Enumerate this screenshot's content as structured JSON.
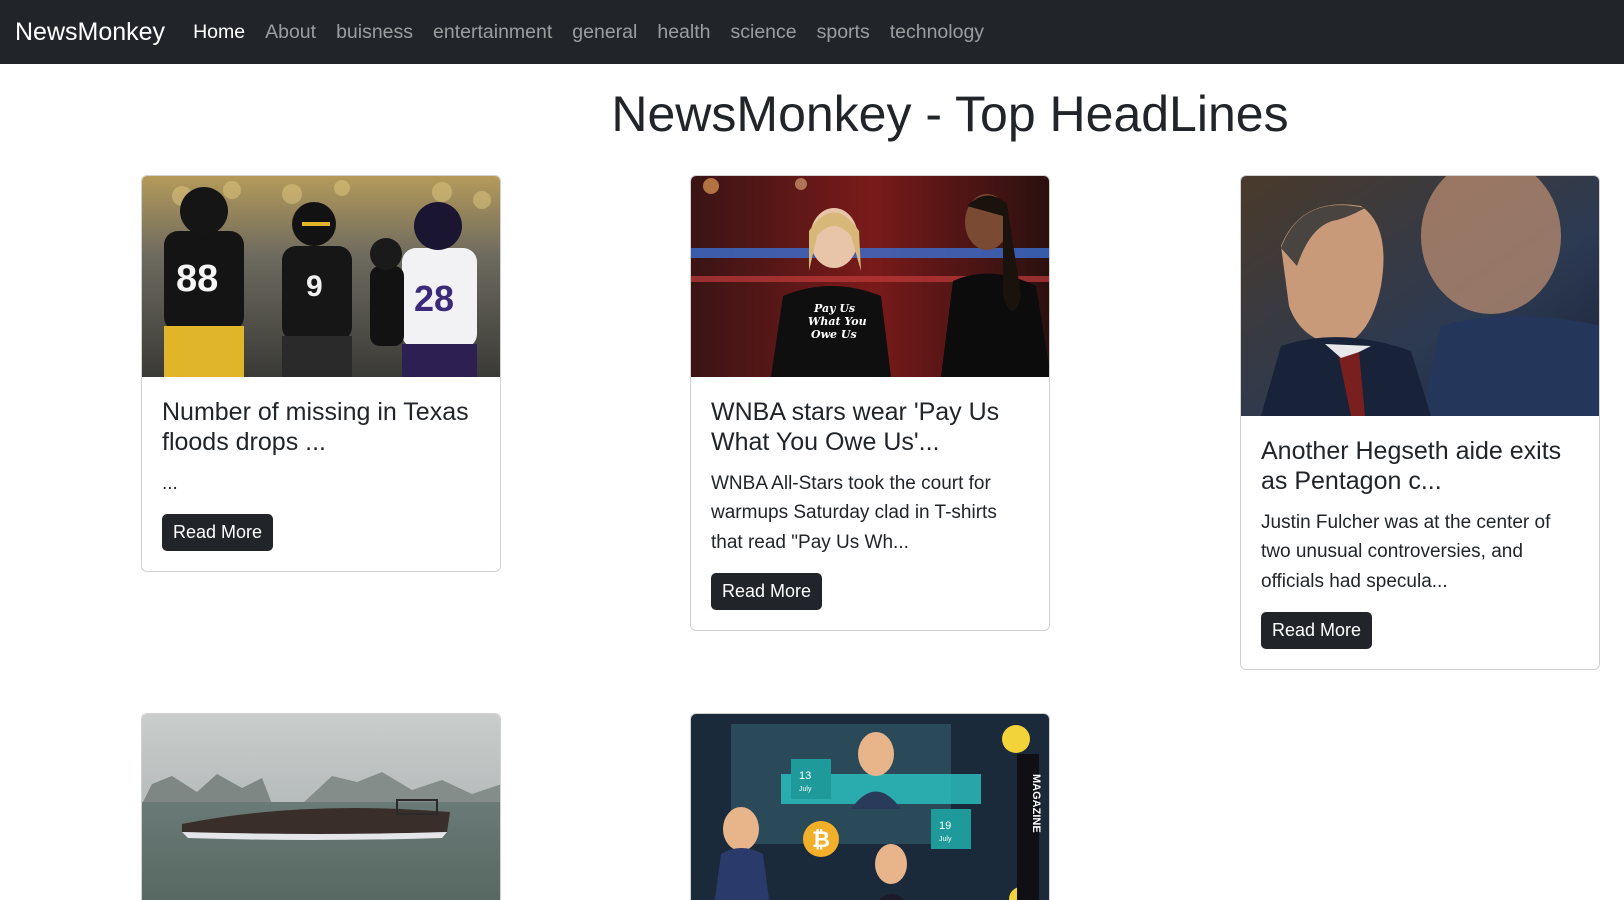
{
  "navbar": {
    "brand": "NewsMonkey",
    "links": [
      "Home",
      "About",
      "buisness",
      "entertainment",
      "general",
      "health",
      "science",
      "sports",
      "technology"
    ]
  },
  "page_title": "NewsMonkey - Top HeadLines",
  "cards": [
    {
      "title": "Number of missing in Texas floods drops ...",
      "description": "...",
      "button": "Read More",
      "image_icon": "football-players-photo"
    },
    {
      "title": "WNBA stars wear 'Pay Us What You Owe Us'...",
      "description": "WNBA All-Stars took the court for warmups Saturday clad in T-shirts that read \"Pay Us Wh...",
      "button": "Read More",
      "image_icon": "basketball-players-photo",
      "image_text": [
        "Pay Us",
        "What You",
        "Owe Us"
      ]
    },
    {
      "title": "Another Hegseth aide exits as Pentagon c...",
      "description": "Justin Fulcher was at the center of two unusual controversies, and officials had specula...",
      "button": "Read More",
      "image_icon": "officials-portrait-photo"
    },
    {
      "image_icon": "capsized-boat-photo"
    },
    {
      "image_icon": "crypto-magazine-illustration",
      "image_text": [
        "13",
        "July",
        "19",
        "July",
        "MAGAZINE"
      ]
    }
  ],
  "colors": {
    "navbar_bg": "#212529",
    "button_bg": "#212529",
    "nav_active": "#ffffff",
    "nav_inactive": "rgba(255,255,255,0.55)"
  }
}
